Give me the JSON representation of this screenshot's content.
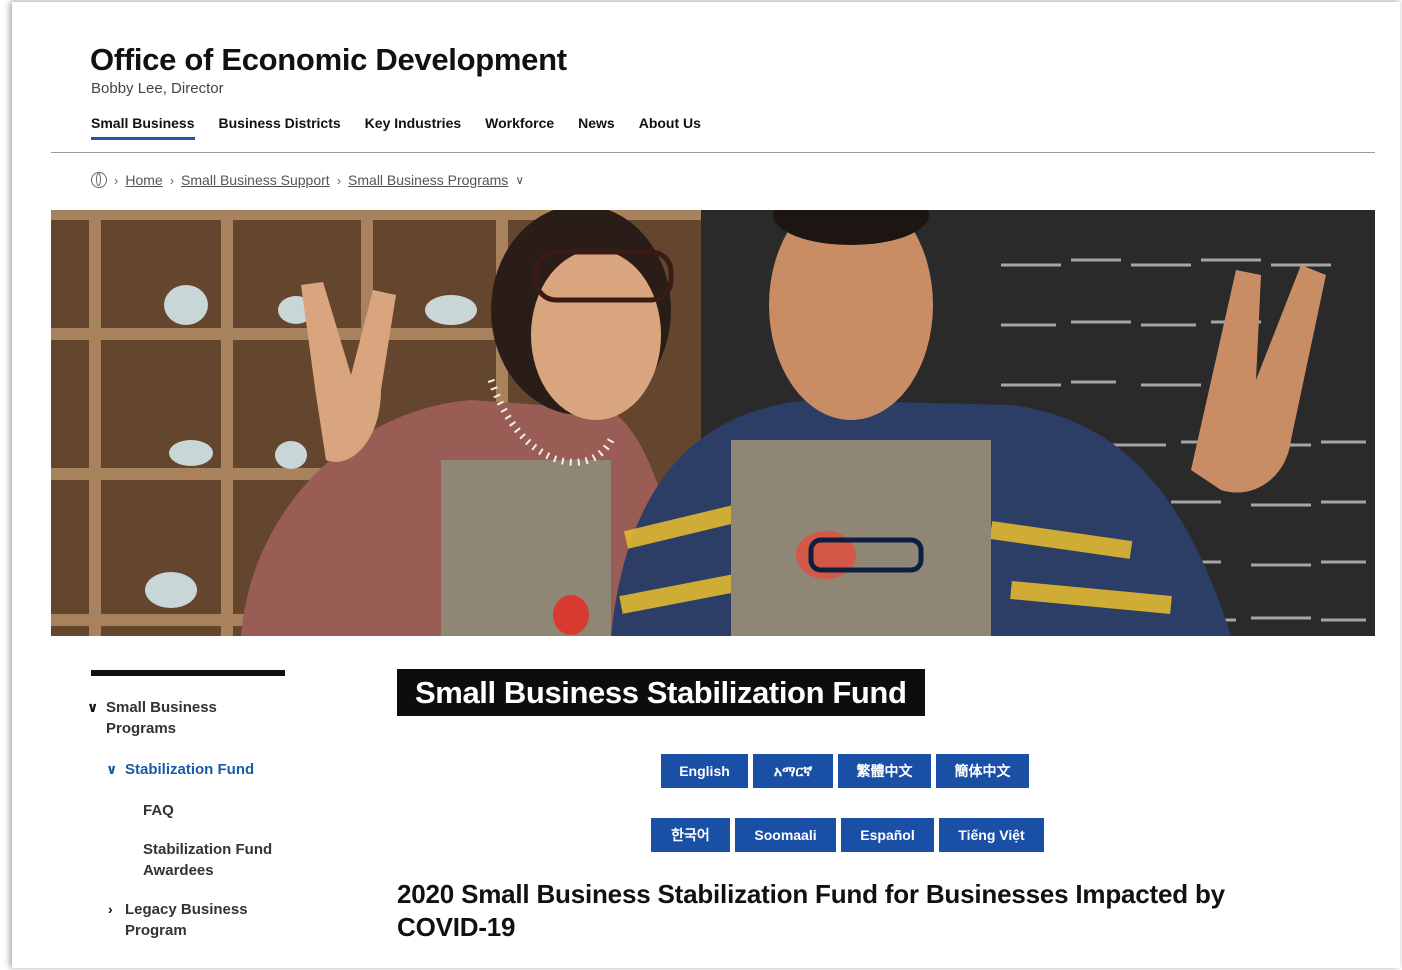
{
  "header": {
    "title": "Office of Economic Development",
    "subtitle": "Bobby Lee, Director"
  },
  "nav": {
    "items": [
      {
        "label": "Small Business",
        "active": true
      },
      {
        "label": "Business Districts"
      },
      {
        "label": "Key Industries"
      },
      {
        "label": "Workforce"
      },
      {
        "label": "News"
      },
      {
        "label": "About Us"
      }
    ]
  },
  "breadcrumb": {
    "items": [
      "Home",
      "Small Business Support",
      "Small Business Programs"
    ]
  },
  "sidebar": {
    "items": [
      {
        "label": "Small Business Programs",
        "expanded": true
      },
      {
        "label": "Stabilization Fund",
        "expanded": true,
        "active": true
      },
      {
        "label": "FAQ"
      },
      {
        "label": "Stabilization Fund Awardees"
      },
      {
        "label": "Legacy Business Program",
        "expanded": false
      }
    ]
  },
  "main": {
    "title": "Small Business Stabilization Fund",
    "languages_row1": [
      "English",
      "አማርኛ",
      "繁體中文",
      "簡体中文"
    ],
    "languages_row2": [
      "한국어",
      "Soomaali",
      "Español",
      "Tiếng Việt"
    ],
    "heading": "2020 Small Business Stabilization Fund for Businesses Impacted by COVID-19"
  },
  "colors": {
    "accent": "#1a4fa6",
    "title_box": "#0d0d0d"
  },
  "icons": {
    "breadcrumb_home": "globe-icon",
    "breadcrumb_separator": "chevron-right-icon",
    "breadcrumb_dropdown": "chevron-down-icon",
    "sidebar_expanded": "chevron-down-icon",
    "sidebar_collapsed": "chevron-right-icon"
  }
}
